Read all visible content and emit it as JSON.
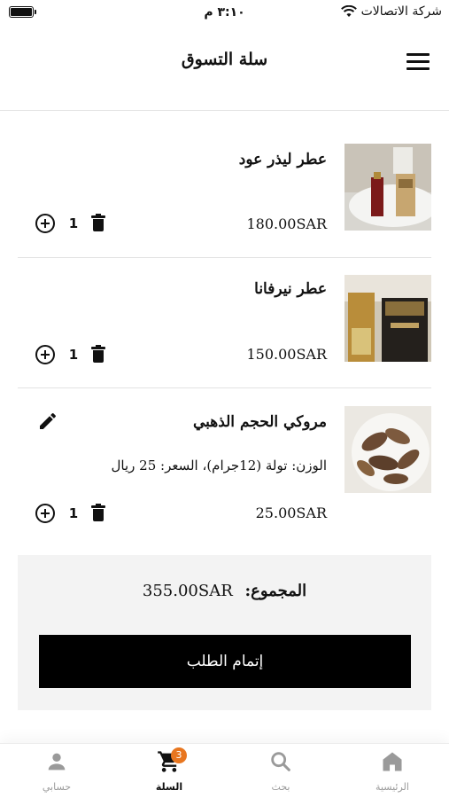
{
  "status_bar": {
    "carrier": "شركة الاتصالات",
    "time": "٣:١٠ م"
  },
  "header": {
    "title": "سلة التسوق"
  },
  "cart": {
    "items": [
      {
        "name": "عطر ليذر عود",
        "price": "180.00SAR",
        "quantity": "1"
      },
      {
        "name": "عطر نيرفانا",
        "price": "150.00SAR",
        "quantity": "1"
      },
      {
        "name": "مروكي الحجم الذهبي",
        "description": "الوزن: تولة (12جرام)، السعر: 25 ريال",
        "price": "25.00SAR",
        "quantity": "1"
      }
    ]
  },
  "summary": {
    "total_label": "المجموع:",
    "total_value": "355.00SAR",
    "checkout_label": "إتمام الطلب"
  },
  "bottom_nav": {
    "items": [
      {
        "label": "حسابي",
        "icon": "person-icon"
      },
      {
        "label": "السلة",
        "icon": "cart-icon",
        "badge": "3",
        "active": true
      },
      {
        "label": "بحث",
        "icon": "search-icon"
      },
      {
        "label": "الرئيسية",
        "icon": "home-icon"
      }
    ]
  },
  "colors": {
    "accent": "#e8761f",
    "checkout_bg": "#000000",
    "summary_bg": "#f3f3f3"
  }
}
